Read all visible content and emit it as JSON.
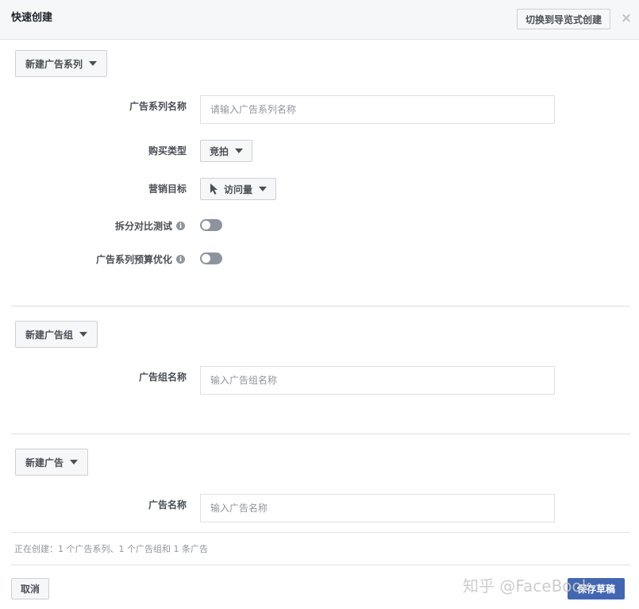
{
  "dialog": {
    "title": "快速创建",
    "switch_button": "切换到导览式创建",
    "close_glyph": "×"
  },
  "campaign": {
    "dropdown_label": "新建广告系列",
    "name_label": "广告系列名称",
    "name_placeholder": "请输入广告系列名称",
    "buying_type_label": "购买类型",
    "buying_type_value": "竞拍",
    "objective_label": "营销目标",
    "objective_value": "访问量",
    "objective_icon": "cursor-icon",
    "split_test_label": "拆分对比测试",
    "split_test_on": false,
    "budget_opt_label": "广告系列预算优化",
    "budget_opt_on": false,
    "info_glyph": "i"
  },
  "adset": {
    "dropdown_label": "新建广告组",
    "name_label": "广告组名称",
    "name_placeholder": "输入广告组名称"
  },
  "ad": {
    "dropdown_label": "新建广告",
    "name_label": "广告名称",
    "name_placeholder": "输入广告名称"
  },
  "footer": {
    "summary": "正在创建：1 个广告系列、1 个广告组和 1 条广告",
    "cancel_label": "取消",
    "save_label": "保存草稿"
  },
  "watermark": "知乎 @FaceBook",
  "colors": {
    "primary": "#4267b2",
    "toggle_off": "#8d949e",
    "header_bg": "#f6f7f9"
  }
}
